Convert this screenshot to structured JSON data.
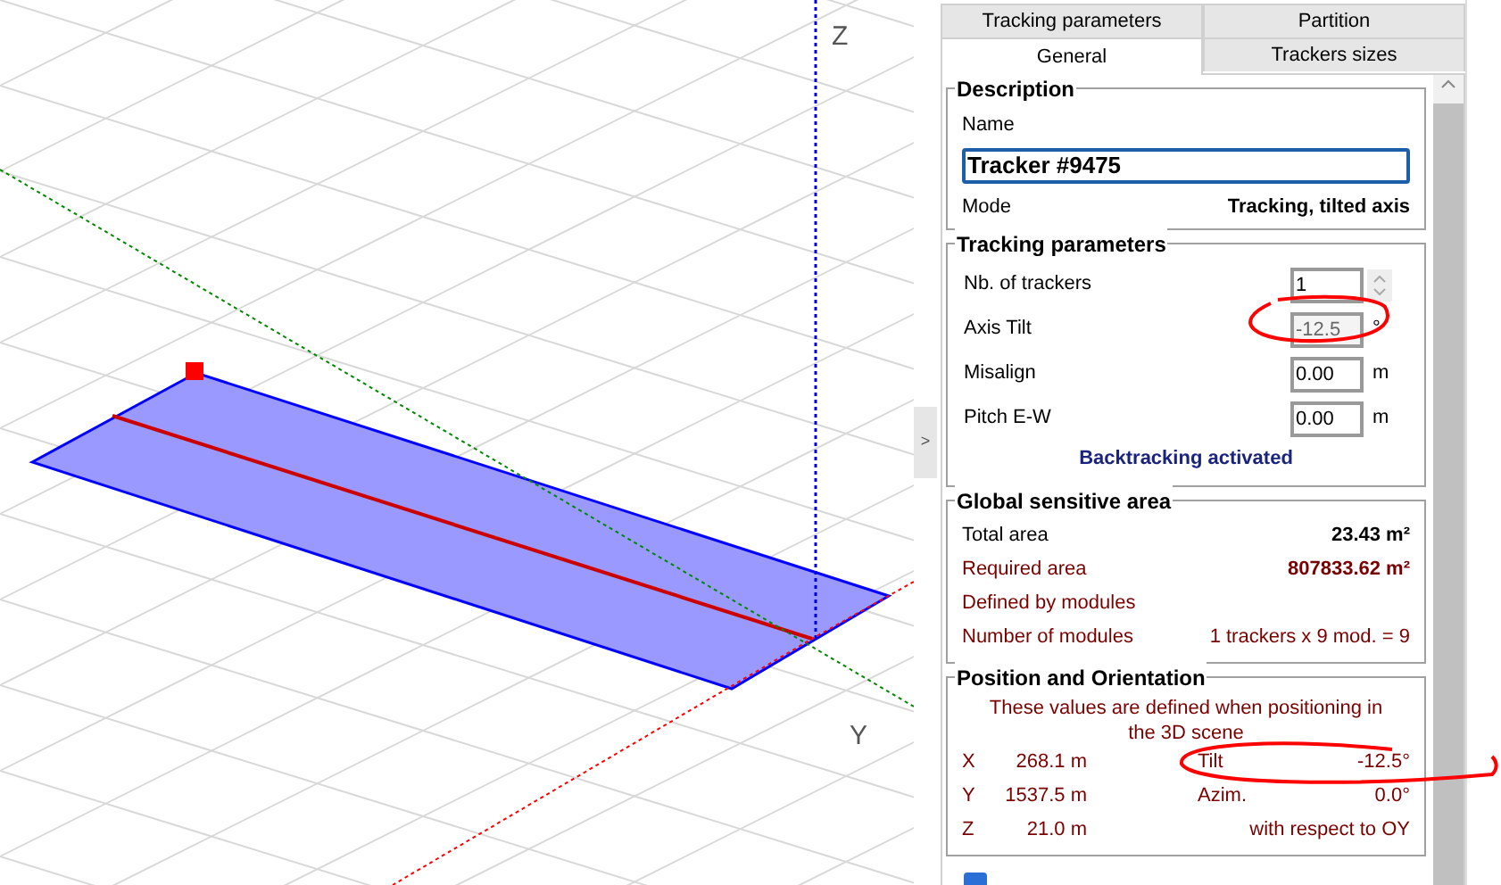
{
  "viewport": {
    "axis_labels": [
      "Z",
      "Y"
    ],
    "collapse_button": ">"
  },
  "tabs_row_1": [
    {
      "label": "Tracking parameters",
      "selected": false
    },
    {
      "label": "Partition",
      "selected": false
    }
  ],
  "tabs_row_2": [
    {
      "label": "General",
      "selected": true
    },
    {
      "label": "Trackers sizes",
      "selected": false
    }
  ],
  "description": {
    "title": "Description",
    "name_label": "Name",
    "name_value": "Tracker #9475",
    "mode_label": "Mode",
    "mode_value": "Tracking, tilted axis"
  },
  "tracking_parameters": {
    "title": "Tracking parameters",
    "fields": [
      {
        "label": "Nb. of trackers",
        "value": "1",
        "disabled": false,
        "kind": "spinner"
      },
      {
        "label": "Axis Tilt",
        "value": "-12.5",
        "unit": "°",
        "disabled": true,
        "kind": "field"
      },
      {
        "label": "Misalign",
        "value": "0.00",
        "unit": "m",
        "disabled": false,
        "kind": "field"
      },
      {
        "label": "Pitch E-W",
        "value": "0.00",
        "unit": "m",
        "disabled": false,
        "kind": "field"
      }
    ],
    "status": "Backtracking activated"
  },
  "global_sensitive_area": {
    "title": "Global sensitive area",
    "rows": [
      {
        "label": "Total area",
        "value": "23.43 m²",
        "kind": "bold"
      },
      {
        "label": "Required area",
        "value": "807833.62 m²",
        "kind": "alert"
      },
      {
        "label": "Defined by modules",
        "kind": "note"
      },
      {
        "label": "Number of modules",
        "value": "1 trackers x 9 mod.  = 9",
        "kind": "note"
      }
    ]
  },
  "position_and_orientation": {
    "title": "Position and Orientation",
    "note": "These values are defined when positioning in the 3D scene",
    "rows": [
      {
        "axis": "X",
        "value": "268.1 m",
        "label": "Tilt",
        "angle": "-12.5°"
      },
      {
        "axis": "Y",
        "value": "1537.5 m",
        "label": "Azim.",
        "angle": "0.0°"
      },
      {
        "axis": "Z",
        "value": "21.0 m",
        "label": "with respect to OY"
      }
    ]
  },
  "bottom_checkbox": {
    "checked": true
  }
}
